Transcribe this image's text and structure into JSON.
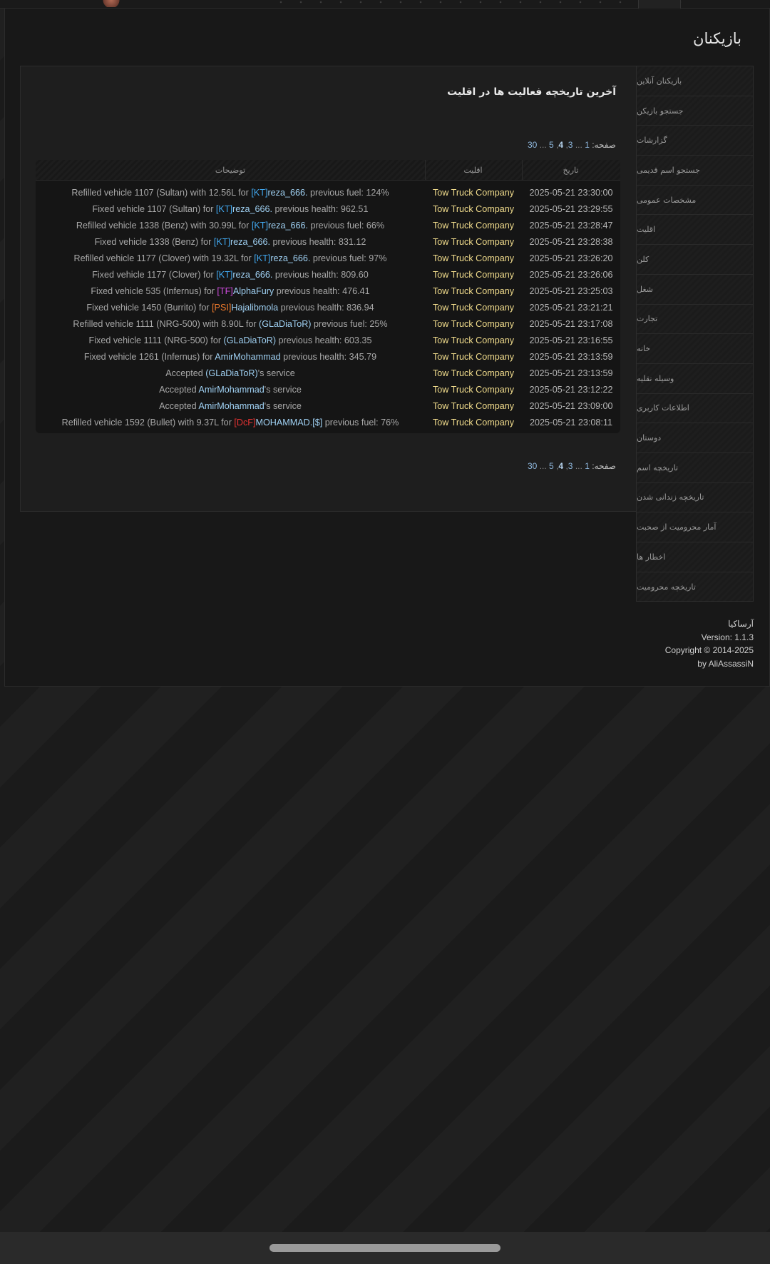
{
  "page": {
    "title": "بازیکنان"
  },
  "sidebar": {
    "items": [
      {
        "label": "بازیکنان آنلاین"
      },
      {
        "label": "جستجو بازیکن"
      },
      {
        "label": "گزارشات"
      },
      {
        "label": "جستجو اسم قدیمی"
      },
      {
        "label": "مشخصات عمومی"
      },
      {
        "label": "اقلیت"
      },
      {
        "label": "کلن"
      },
      {
        "label": "شغل"
      },
      {
        "label": "تجارت"
      },
      {
        "label": "خانه"
      },
      {
        "label": "وسیله نقلیه"
      },
      {
        "label": "اطلاعات کاربری"
      },
      {
        "label": "دوستان"
      },
      {
        "label": "تاریخچه اسم"
      },
      {
        "label": "تاریخچه زندانی شدن"
      },
      {
        "label": "آمار محرومیت از صحبت"
      },
      {
        "label": "اخطار ها"
      },
      {
        "label": "تاریخچه محرومیت"
      }
    ]
  },
  "panel": {
    "title": "آخرین تاریخچه فعالیت ها در اقلیت"
  },
  "pagination": {
    "label": "صفحه:",
    "first": "1",
    "ellipsis1": "...",
    "p3": "3",
    "p4": "4",
    "p5": "5",
    "ellipsis2": "...",
    "last": "30"
  },
  "table": {
    "headers": {
      "date": "تاریخ",
      "faction": "اقلیت",
      "desc": "توضیحات"
    },
    "rows": [
      {
        "date": "2025-05-21 23:30:00",
        "faction": "Tow Truck Company",
        "pre": "Refilled vehicle 1107 (Sultan) with 12.56L for ",
        "tag": "[KT]",
        "name": "reza_666.",
        "post": " previous fuel: 124%"
      },
      {
        "date": "2025-05-21 23:29:55",
        "faction": "Tow Truck Company",
        "pre": "Fixed vehicle 1107 (Sultan) for ",
        "tag": "[KT]",
        "name": "reza_666.",
        "post": " previous health: 962.51"
      },
      {
        "date": "2025-05-21 23:28:47",
        "faction": "Tow Truck Company",
        "pre": "Refilled vehicle 1338 (Benz) with 30.99L for ",
        "tag": "[KT]",
        "name": "reza_666.",
        "post": " previous fuel: 66%"
      },
      {
        "date": "2025-05-21 23:28:38",
        "faction": "Tow Truck Company",
        "pre": "Fixed vehicle 1338 (Benz) for ",
        "tag": "[KT]",
        "name": "reza_666.",
        "post": " previous health: 831.12"
      },
      {
        "date": "2025-05-21 23:26:20",
        "faction": "Tow Truck Company",
        "pre": "Refilled vehicle 1177 (Clover) with 19.32L for ",
        "tag": "[KT]",
        "name": "reza_666.",
        "post": " previous fuel: 97%"
      },
      {
        "date": "2025-05-21 23:26:06",
        "faction": "Tow Truck Company",
        "pre": "Fixed vehicle 1177 (Clover) for ",
        "tag": "[KT]",
        "name": "reza_666.",
        "post": " previous health: 809.60"
      },
      {
        "date": "2025-05-21 23:25:03",
        "faction": "Tow Truck Company",
        "pre": "Fixed vehicle 535 (Infernus) for ",
        "tag": "[TF]",
        "name": "AlphaFury",
        "post": " previous health: 476.41"
      },
      {
        "date": "2025-05-21 23:21:21",
        "faction": "Tow Truck Company",
        "pre": "Fixed vehicle 1450 (Burrito) for ",
        "tag": "[PSI]",
        "name": "Hajalibmola",
        "post": " previous health: 836.94"
      },
      {
        "date": "2025-05-21 23:17:08",
        "faction": "Tow Truck Company",
        "pre": "Refilled vehicle 1111 (NRG-500) with 8.90L for ",
        "tag": "",
        "name": "(GLaDiaToR)",
        "post": " previous fuel: 25%"
      },
      {
        "date": "2025-05-21 23:16:55",
        "faction": "Tow Truck Company",
        "pre": "Fixed vehicle 1111 (NRG-500) for ",
        "tag": "",
        "name": "(GLaDiaToR)",
        "post": " previous health: 603.35"
      },
      {
        "date": "2025-05-21 23:13:59",
        "faction": "Tow Truck Company",
        "pre": "Fixed vehicle 1261 (Infernus) for ",
        "tag": "",
        "name": "AmirMohammad",
        "post": " previous health: 345.79"
      },
      {
        "date": "2025-05-21 23:13:59",
        "faction": "Tow Truck Company",
        "pre": "Accepted ",
        "tag": "",
        "name": "(GLaDiaToR)",
        "post": "'s service"
      },
      {
        "date": "2025-05-21 23:12:22",
        "faction": "Tow Truck Company",
        "pre": "Accepted ",
        "tag": "",
        "name": "AmirMohammad",
        "post": "'s service"
      },
      {
        "date": "2025-05-21 23:09:00",
        "faction": "Tow Truck Company",
        "pre": "Accepted ",
        "tag": "",
        "name": "AmirMohammad",
        "post": "'s service"
      },
      {
        "date": "2025-05-21 23:08:11",
        "faction": "Tow Truck Company",
        "pre": "Refilled vehicle 1592 (Bullet) with 9.37L for ",
        "tag": "[DcF]",
        "name": "MOHAMMAD.[$]",
        "post": " previous fuel: 76%"
      }
    ]
  },
  "footer": {
    "brand": "آرساکیا",
    "version": "Version: 1.1.3",
    "copyright": "Copyright © 2014-2025",
    "author": "by AliAssassiN"
  },
  "colors": {
    "faction": "#f1dc8c",
    "player_name": "#9fd0f2",
    "tag_kt": "#41a8f0",
    "tag_tf": "#d04ce0",
    "tag_psi": "#f07a2c",
    "tag_dcf": "#e63232"
  }
}
